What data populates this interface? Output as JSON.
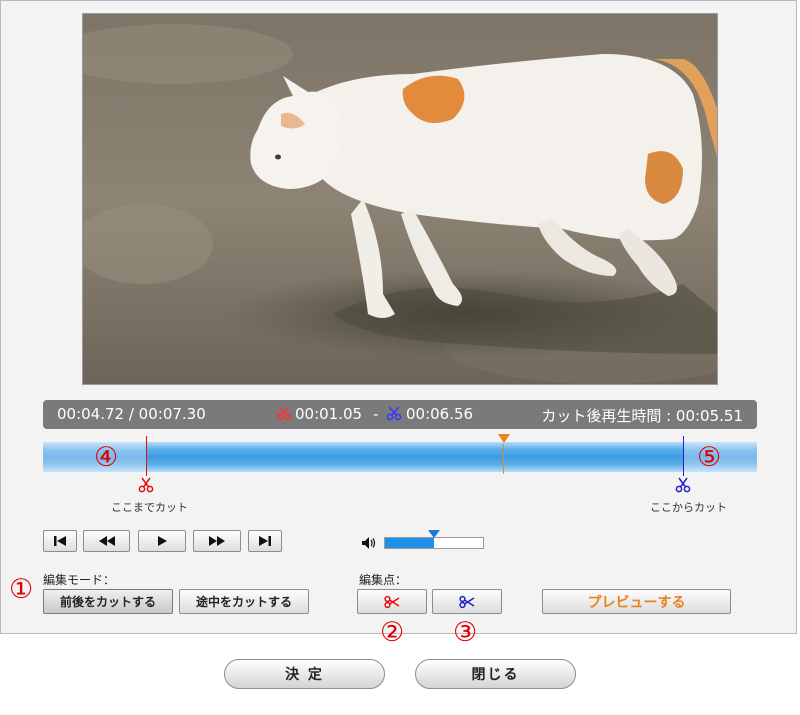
{
  "player": {
    "current_time": "00:04.72 / 00:07.30",
    "cut_start": "00:01.05",
    "range_separator": "-",
    "cut_end": "00:06.56",
    "duration_after_cut": "カット後再生時間 : 00:05.51",
    "volume_level": 0.5,
    "playhead_fraction": 0.646,
    "cut_start_fraction": 0.143,
    "cut_end_fraction": 0.897
  },
  "timeline": {
    "start_label": "ここまでカット",
    "end_label": "ここからカット"
  },
  "controls": {
    "edit_mode_label": "編集モード：",
    "edit_point_label": "編集点：",
    "cut_before_after": "前後をカットする",
    "cut_middle": "途中をカットする",
    "preview": "プレビューする"
  },
  "footer": {
    "ok": "決 定",
    "close": "閉じる"
  },
  "annotations": {
    "n1": "①",
    "n2": "②",
    "n3": "③",
    "n4": "④",
    "n5": "⑤"
  },
  "colors": {
    "start_scissors": "#e01010",
    "end_scissors": "#1a1acc",
    "playhead": "#e8821f",
    "annotation": "#e00000",
    "preview_text": "#e8821f"
  },
  "icons": {
    "start_marker": "red-scissors-icon",
    "end_marker": "blue-scissors-icon",
    "volume": "speaker-icon",
    "playback": [
      "skip-to-start-icon",
      "rewind-icon",
      "play-icon",
      "fast-forward-icon",
      "skip-to-end-icon"
    ]
  }
}
